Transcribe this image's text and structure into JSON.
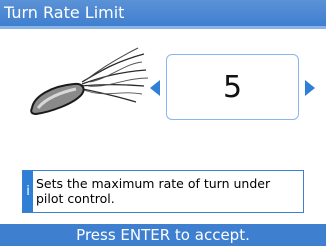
{
  "header": {
    "title": "Turn Rate Limit"
  },
  "setting": {
    "value": "5"
  },
  "info": {
    "icon_glyph": "i",
    "text": "Sets the maximum rate of turn under pilot control."
  },
  "footer": {
    "prompt": "Press ENTER to accept."
  },
  "colors": {
    "accent": "#3f7fd0",
    "arrow": "#2f7fd6",
    "box_border": "#8ab6ee"
  }
}
